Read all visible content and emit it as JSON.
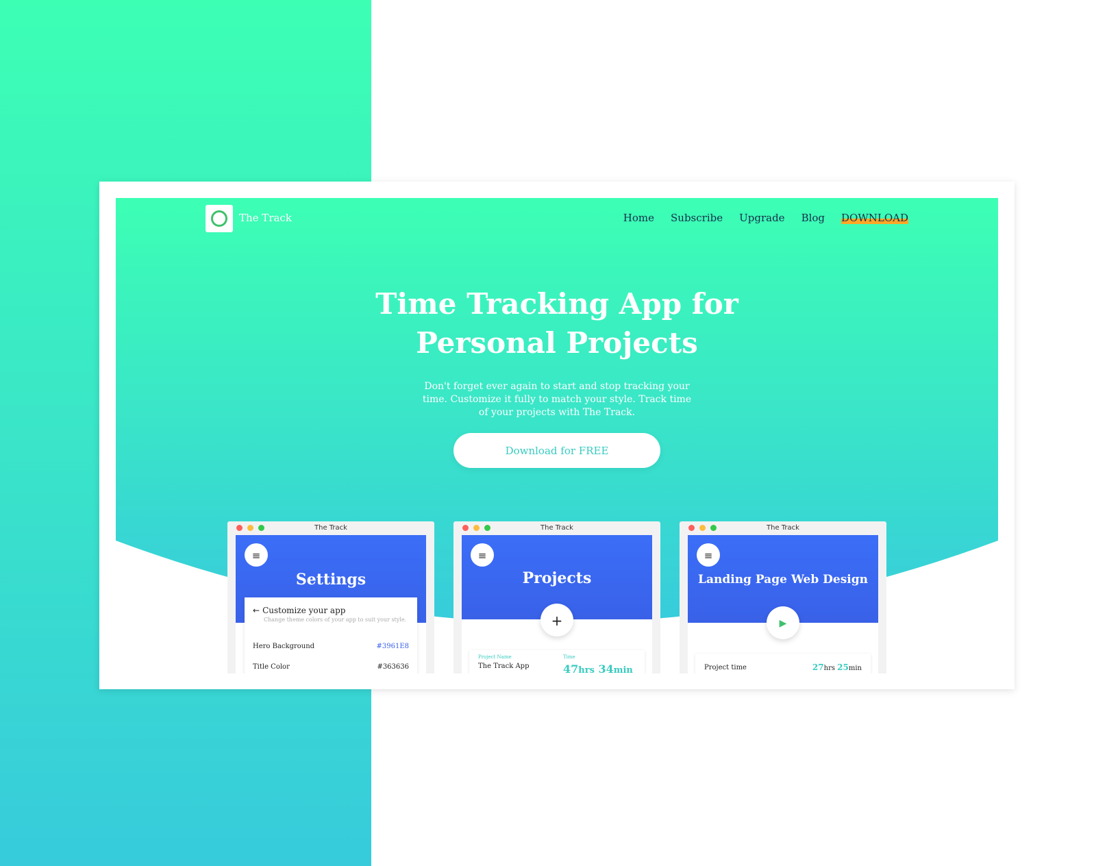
{
  "brand": {
    "name": "The Track",
    "logo_icon": "ring-logo-icon"
  },
  "nav": {
    "items": [
      "Home",
      "Subscribe",
      "Upgrade",
      "Blog"
    ],
    "download": "DOWNLOAD"
  },
  "hero": {
    "title_line1": "Time Tracking App for",
    "title_line2": "Personal Projects",
    "subtitle": "Don't forget ever again to start and stop tracking your time. Customize it fully to match your style. Track time of your projects with The Track.",
    "cta": "Download for FREE"
  },
  "colors": {
    "gradient_top": "#3cffb4",
    "gradient_bottom": "#37cbdc",
    "app_blue": "#3961e8",
    "accent_orange": "#ffa726"
  },
  "windows": [
    {
      "window_title": "The Track",
      "screen_title": "Settings",
      "panel_title": "Customize your app",
      "panel_subtitle": "Change theme colors of your app to suit your style.",
      "rows": [
        {
          "label": "Hero Background",
          "value": "#3961E8",
          "value_color": "#3961e8"
        },
        {
          "label": "Title Color",
          "value": "#363636",
          "value_color": "#222222"
        }
      ]
    },
    {
      "window_title": "The Track",
      "screen_title": "Projects",
      "project_name_label": "Project Name",
      "project_name": "The Track App",
      "time_label": "Time",
      "time_hours": "47",
      "time_hours_unit": "hrs",
      "time_minutes": "34",
      "time_minutes_unit": "min"
    },
    {
      "window_title": "The Track",
      "screen_title": "Landing Page Web Design",
      "project_time_label": "Project time",
      "hours": "27",
      "hours_unit": "hrs",
      "minutes": "25",
      "minutes_unit": "min"
    }
  ]
}
